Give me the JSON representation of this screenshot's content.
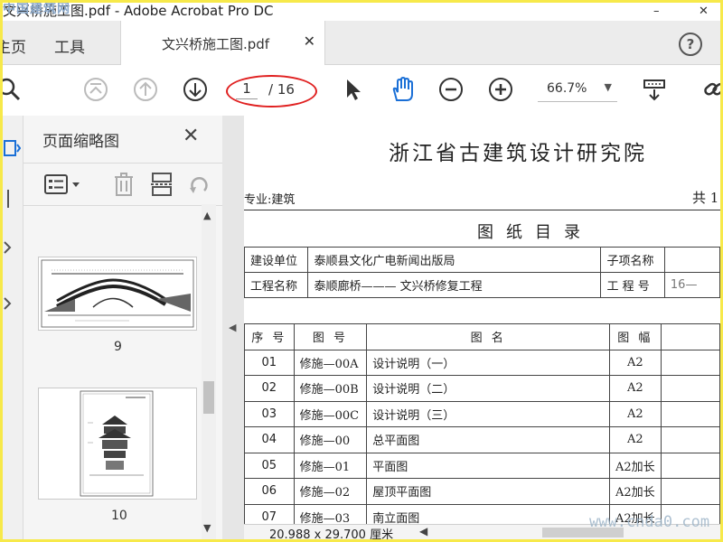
{
  "window": {
    "title": "文兴桥施工图.pdf - Adobe Acrobat Pro DC",
    "watermark_top": "中国建筑网",
    "watermark_bottom": "www.cnda0.com",
    "btn_min": "–",
    "btn_close": "✕"
  },
  "tabs": {
    "home": "主页",
    "tools": "工具",
    "document": "文兴桥施工图.pdf",
    "close": "✕",
    "help": "?"
  },
  "toolbar": {
    "page_current": "1",
    "page_total": "/ 16",
    "zoom": "66.7%",
    "zoom_arrow": "▼"
  },
  "panel": {
    "title": "页面缩略图",
    "close": "✕",
    "thumb_labels": [
      "9",
      "10"
    ],
    "scroll_up": "▲",
    "scroll_down": "▼"
  },
  "collapse_arrow": "◀",
  "document": {
    "org": "浙江省古建筑设计研究院",
    "major": "专业:建筑",
    "total": "共 1",
    "dir_title": "图纸目录",
    "info_rows": [
      {
        "label": "建设单位",
        "value": "泰顺县文化广电新闻出版局",
        "label2": "子项名称",
        "value2": ""
      },
      {
        "label": "工程名称",
        "value": "泰顺廊桥——— 文兴桥修复工程",
        "label2": "工 程 号",
        "value2": "16—"
      }
    ],
    "headers": {
      "no": "序 号",
      "code": "图 号",
      "name": "图 名",
      "size": "图 幅"
    },
    "rows": [
      {
        "no": "01",
        "code": "修施—00A",
        "name": "设计说明（一）",
        "size": "A2"
      },
      {
        "no": "02",
        "code": "修施—00B",
        "name": "设计说明（二）",
        "size": "A2"
      },
      {
        "no": "03",
        "code": "修施—00C",
        "name": "设计说明（三）",
        "size": "A2"
      },
      {
        "no": "04",
        "code": "修施—00",
        "name": "总平面图",
        "size": "A2"
      },
      {
        "no": "05",
        "code": "修施—01",
        "name": "平面图",
        "size": "A2加长"
      },
      {
        "no": "06",
        "code": "修施—02",
        "name": "屋顶平面图",
        "size": "A2加长"
      },
      {
        "no": "07",
        "code": "修施—03",
        "name": "南立面图",
        "size": "A2加长"
      }
    ]
  },
  "status": {
    "page_size": "20.988 x 29.700 厘米",
    "scroll_left": "◀"
  },
  "colors": {
    "frame_border": "#f7e94a",
    "annotation": "#e02020",
    "hand_tool": "#1a6fd6"
  }
}
